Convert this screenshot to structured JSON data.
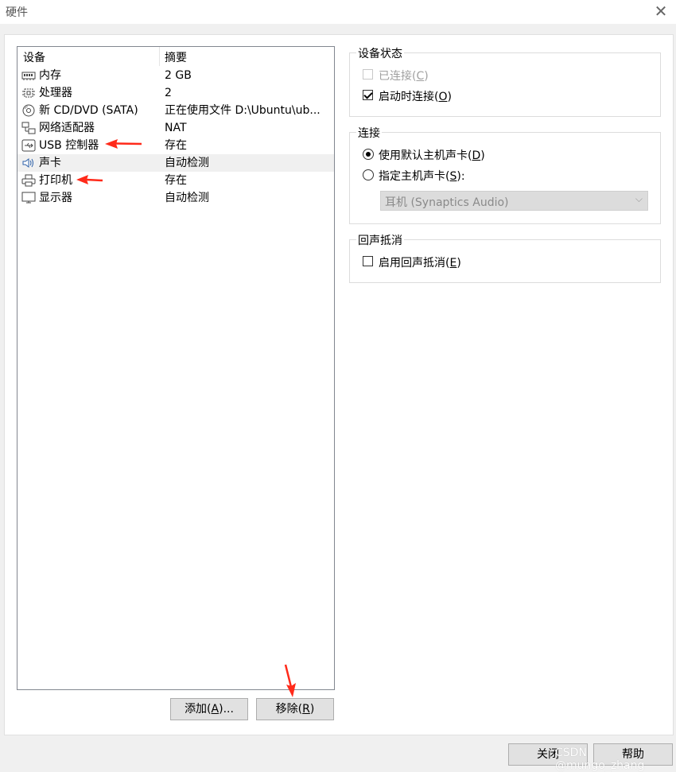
{
  "window": {
    "title": "硬件"
  },
  "device_list": {
    "headers": {
      "device": "设备",
      "summary": "摘要"
    },
    "rows": [
      {
        "name": "内存",
        "summary": "2 GB",
        "icon": "memory-icon"
      },
      {
        "name": "处理器",
        "summary": "2",
        "icon": "cpu-icon"
      },
      {
        "name": "新 CD/DVD (SATA)",
        "summary": "正在使用文件 D:\\Ubuntu\\ub...",
        "icon": "cd-dvd-icon"
      },
      {
        "name": "网络适配器",
        "summary": "NAT",
        "icon": "network-adapter-icon"
      },
      {
        "name": "USB 控制器",
        "summary": "存在",
        "icon": "usb-icon"
      },
      {
        "name": "声卡",
        "summary": "自动检测",
        "icon": "speaker-icon",
        "selected": true
      },
      {
        "name": "打印机",
        "summary": "存在",
        "icon": "printer-icon"
      },
      {
        "name": "显示器",
        "summary": "自动检测",
        "icon": "monitor-icon"
      }
    ]
  },
  "buttons": {
    "add": "添加(A)...",
    "add_prefix": "添加(",
    "add_key": "A",
    "add_suffix": ")...",
    "remove_prefix": "移除(",
    "remove_key": "R",
    "remove_suffix": ")",
    "close": "关闭",
    "help": "帮助"
  },
  "device_status": {
    "title": "设备状态",
    "connected_prefix": "已连接(",
    "connected_key": "C",
    "connected_suffix": ")",
    "connected_checked": false,
    "connect_on_start_prefix": "启动时连接(",
    "connect_on_start_key": "O",
    "connect_on_start_suffix": ")",
    "connect_on_start_checked": true
  },
  "connection": {
    "title": "连接",
    "default_prefix": "使用默认主机声卡(",
    "default_key": "D",
    "default_suffix": ")",
    "specify_prefix": "指定主机声卡(",
    "specify_key": "S",
    "specify_suffix": "):",
    "selected": "default",
    "device_value": "耳机 (Synaptics Audio)"
  },
  "echo_cancel": {
    "title": "回声抵消",
    "enable_prefix": "启用回声抵消(",
    "enable_key": "E",
    "enable_suffix": ")",
    "checked": false
  },
  "watermark": "CSDN @mungo_zhang",
  "colors": {
    "annotation_arrow": "#ff2a1a",
    "selected_row": "#f0f0f0",
    "button_bg": "#e1e1e1"
  }
}
